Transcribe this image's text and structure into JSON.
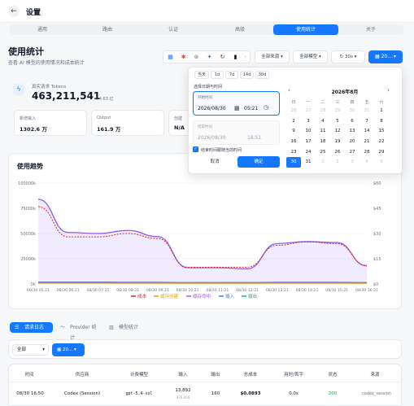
{
  "header": {
    "back_icon": "arrow-left-icon",
    "title": "设置"
  },
  "tabs": [
    "通用",
    "路由",
    "认证",
    "高级",
    "使用统计",
    "关于"
  ],
  "page": {
    "title": "使用统计",
    "subtitle": "查看 AI 模型的使用情况和成本统计"
  },
  "toolbar": {
    "source": "全部来源",
    "model": "全部模型",
    "refresh": "30s",
    "date": "20..."
  },
  "requests": {
    "label": "真实请求 Tokens",
    "value": "463,211,541",
    "approx": "≈ 4.63 亿"
  },
  "stats": [
    {
      "label": "新增输入",
      "value": "1302.6 万"
    },
    {
      "label": "Output",
      "value": "161.9 万"
    },
    {
      "label": "创建",
      "value": "N/A"
    }
  ],
  "popover": {
    "quick": [
      "当天",
      "1d",
      "7d",
      "14d",
      "30d"
    ],
    "section": "选择日期与时间",
    "start_label": "开始时间",
    "start_date": "2026/08/30",
    "start_time": "05:21",
    "end_label": "结束时间",
    "end_date": "2026/08/30",
    "end_time": "16:51",
    "follow": "结束时间跟随当前时间",
    "cancel": "取消",
    "confirm": "确定",
    "month": "2026年8月",
    "weekdays": [
      "日",
      "一",
      "二",
      "三",
      "四",
      "五",
      "六"
    ],
    "weeks": [
      [
        "26",
        "27",
        "28",
        "29",
        "30",
        "31",
        "1"
      ],
      [
        "2",
        "3",
        "4",
        "5",
        "6",
        "7",
        "8"
      ],
      [
        "9",
        "10",
        "11",
        "12",
        "13",
        "14",
        "15"
      ],
      [
        "16",
        "17",
        "18",
        "19",
        "20",
        "21",
        "22"
      ],
      [
        "23",
        "24",
        "25",
        "26",
        "27",
        "28",
        "29"
      ],
      [
        "30",
        "31",
        "1",
        "2",
        "3",
        "4",
        "5"
      ]
    ]
  },
  "chart_data": {
    "type": "line",
    "title": "使用趋势",
    "x": [
      "08/30 05:21",
      "08/30 06:21",
      "08/30 07:21",
      "08/30 08:21",
      "08/30 09:21",
      "08/30 10:21",
      "08/30 11:21",
      "08/30 12:21",
      "08/30 13:21",
      "08/30 14:21",
      "08/30 15:21",
      "08/30 16:21"
    ],
    "y_left_ticks": [
      "100000k",
      "75000k",
      "50000k",
      "25000k",
      "0k"
    ],
    "y_right_ticks": [
      "$60",
      "$45",
      "$30",
      "$15",
      "$0"
    ],
    "ylim_left": [
      0,
      100000
    ],
    "ylim_right": [
      0,
      60
    ],
    "series": [
      {
        "name": "输入",
        "axis": "left",
        "color": "#8b5cf6",
        "values": [
          84000,
          51000,
          50000,
          53000,
          47000,
          16000,
          16000,
          15000,
          40000,
          42000,
          41000,
          18000
        ]
      },
      {
        "name": "成本",
        "axis": "right",
        "color": "#dc2626",
        "values": [
          46,
          28,
          28,
          30,
          27,
          10,
          10,
          10,
          23,
          25,
          24,
          11
        ]
      },
      {
        "name": "缓存创建",
        "axis": "left",
        "color": "#f59e0b",
        "values": [
          800,
          800,
          800,
          700,
          700,
          600,
          600,
          600,
          700,
          700,
          700,
          600
        ]
      },
      {
        "name": "缓存命中",
        "axis": "left",
        "color": "#a855f7",
        "values": [
          2000,
          2000,
          2000,
          1800,
          1800,
          1500,
          1500,
          1500,
          1800,
          1800,
          1800,
          1500
        ]
      },
      {
        "name": "输出",
        "axis": "left",
        "color": "#10b981",
        "values": [
          1500,
          1500,
          1500,
          1400,
          1400,
          1300,
          1300,
          1300,
          1400,
          1400,
          1400,
          1300
        ]
      }
    ],
    "legend": [
      "成本",
      "缓存创建",
      "缓存命中",
      "输入",
      "输出"
    ],
    "legend_colors": [
      "#dc2626",
      "#f59e0b",
      "#a855f7",
      "#3b82f6",
      "#10b981"
    ]
  },
  "logs": {
    "tabs": [
      "请求日志",
      "Provider 统计",
      "模型统计"
    ],
    "filter": "全部",
    "date": "20...",
    "columns": [
      "时间",
      "供应商",
      "计费模型",
      "输入",
      "输出",
      "总成本",
      "用时/首字",
      "状态",
      "来源"
    ],
    "row": {
      "time": "08/30 16:50",
      "provider": "Codex (Session)",
      "model": "gpt-5.4-sol",
      "input": "13,892",
      "input_sub": "976,000",
      "output": "160",
      "cost": "$0.0893",
      "timing": "0.0s",
      "status": "200",
      "source": "codex_session"
    }
  }
}
